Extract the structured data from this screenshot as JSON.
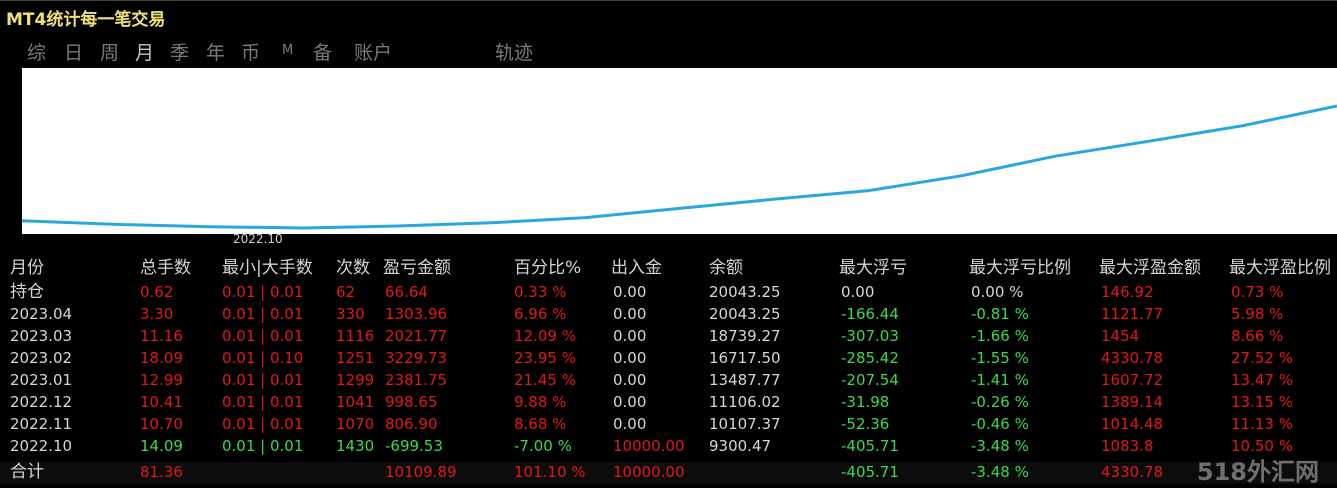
{
  "title": "MT4统计每一笔交易",
  "tabs": [
    "综",
    "日",
    "周",
    "月",
    "季",
    "年",
    "币",
    "M",
    "备",
    "账户",
    "轨迹"
  ],
  "active_tab": "月",
  "chart": {
    "tick_label": "2022.10",
    "line_color": "#29a8e0",
    "points": [
      0.0,
      0.32,
      0.6,
      0.85,
      1.0,
      1.55,
      2.65,
      4.2,
      5.7,
      7.0,
      9.3,
      12.3,
      14.6,
      17.0,
      20.0
    ]
  },
  "table": {
    "headers": [
      "月份",
      "总手数",
      "最小|大手数",
      "次数",
      "盈亏金额",
      "百分比%",
      "出入金",
      "余额",
      "最大浮亏",
      "最大浮亏比例",
      "最大浮盈金额",
      "最大浮盈比例"
    ],
    "rows": [
      [
        "持仓",
        "0.62",
        "0.01 | 0.01",
        "62",
        "66.64",
        "0.33 %",
        "0.00",
        "20043.25",
        "0.00",
        "0.00 %",
        "146.92",
        "0.73 %"
      ],
      [
        "2023.04",
        "3.30",
        "0.01 | 0.01",
        "330",
        "1303.96",
        "6.96 %",
        "0.00",
        "20043.25",
        "-166.44",
        "-0.81 %",
        "1121.77",
        "5.98 %"
      ],
      [
        "2023.03",
        "11.16",
        "0.01 | 0.01",
        "1116",
        "2021.77",
        "12.09 %",
        "0.00",
        "18739.27",
        "-307.03",
        "-1.66 %",
        "1454",
        "8.66 %"
      ],
      [
        "2023.02",
        "18.09",
        "0.01 | 0.10",
        "1251",
        "3229.73",
        "23.95 %",
        "0.00",
        "16717.50",
        "-285.42",
        "-1.55 %",
        "4330.78",
        "27.52 %"
      ],
      [
        "2023.01",
        "12.99",
        "0.01 | 0.01",
        "1299",
        "2381.75",
        "21.45 %",
        "0.00",
        "13487.77",
        "-207.54",
        "-1.41 %",
        "1607.72",
        "13.47 %"
      ],
      [
        "2022.12",
        "10.41",
        "0.01 | 0.01",
        "1041",
        "998.65",
        "9.88 %",
        "0.00",
        "11106.02",
        "-31.98",
        "-0.26 %",
        "1389.14",
        "13.15 %"
      ],
      [
        "2022.11",
        "10.70",
        "0.01 | 0.01",
        "1070",
        "806.90",
        "8.68 %",
        "0.00",
        "10107.37",
        "-52.36",
        "-0.46 %",
        "1014.48",
        "11.13 %"
      ],
      [
        "2022.10",
        "14.09",
        "0.01 | 0.01",
        "1430",
        "-699.53",
        "-7.00 %",
        "10000.00",
        "9300.47",
        "-405.71",
        "-3.48 %",
        "1083.8",
        "10.50 %"
      ]
    ],
    "total": [
      "合计",
      "81.36",
      "",
      "",
      "10109.89",
      "101.10 %",
      "10000.00",
      "",
      "-405.71",
      "-3.48 %",
      "4330.78",
      ""
    ]
  },
  "watermark": "518外汇网"
}
